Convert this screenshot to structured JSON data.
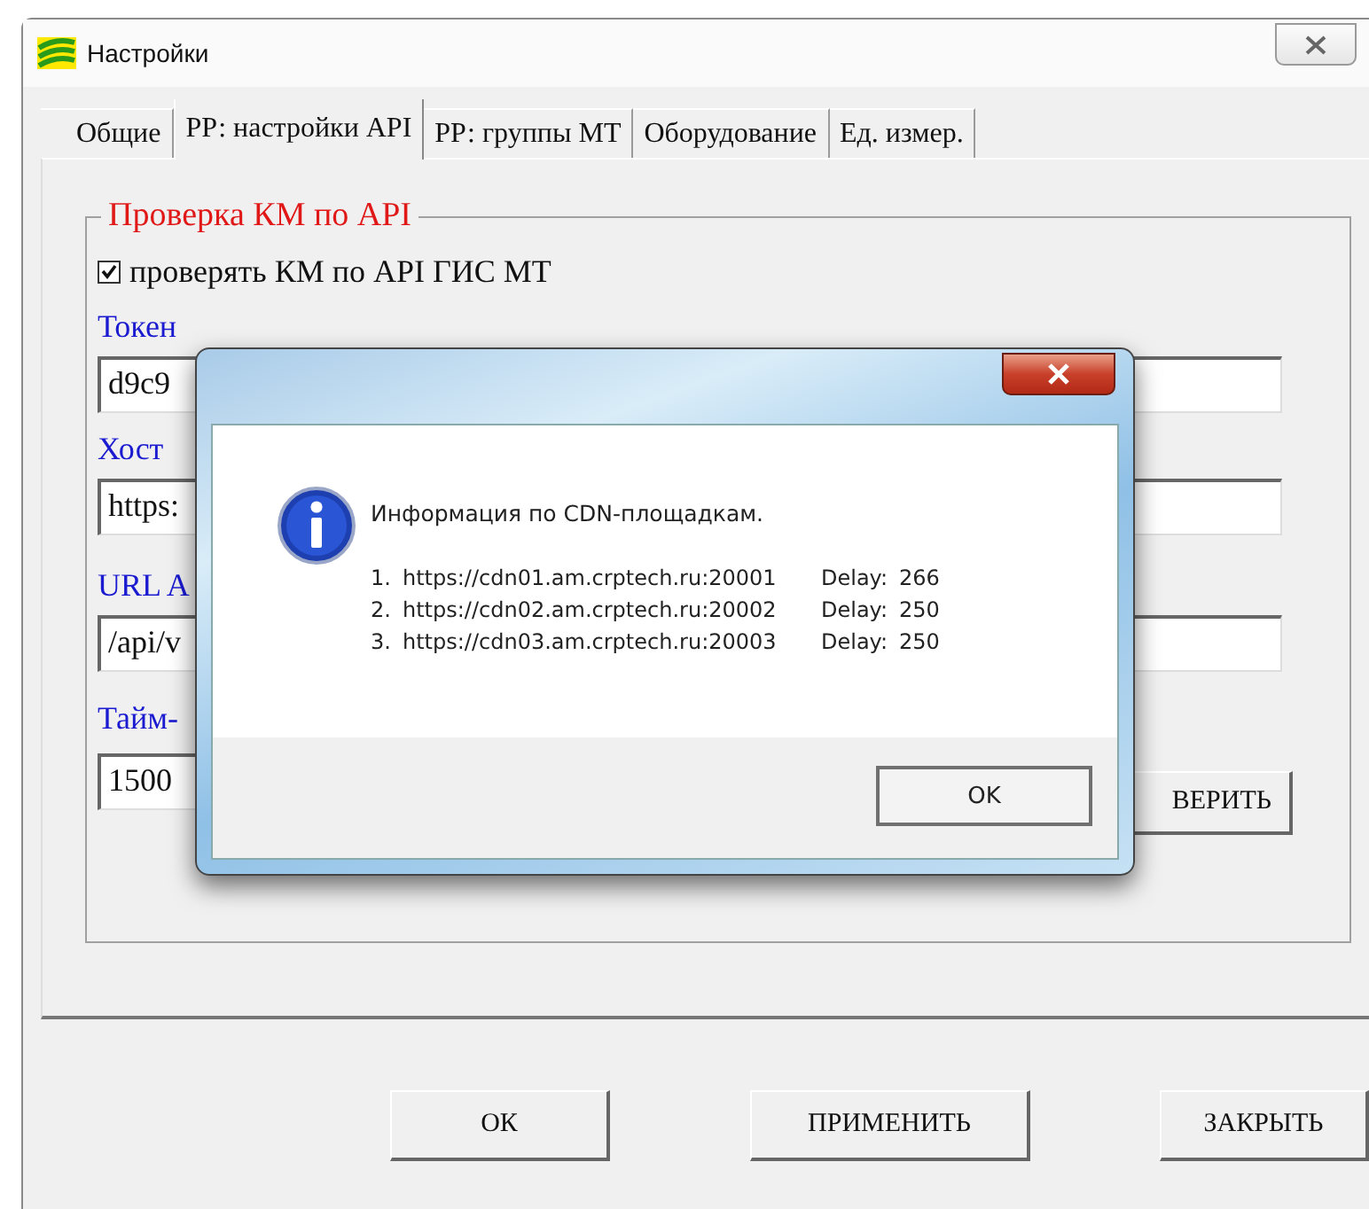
{
  "window": {
    "title": "Настройки"
  },
  "tabs": [
    {
      "label": "Общие",
      "selected": false
    },
    {
      "label": "РР: настройки API",
      "selected": true
    },
    {
      "label": "РР: группы МТ",
      "selected": false
    },
    {
      "label": "Оборудование",
      "selected": false
    },
    {
      "label": "Ед. измер.",
      "selected": false
    }
  ],
  "group": {
    "legend": "Проверка КМ по API",
    "checkbox": {
      "label": "проверять КМ по API ГИС МТ",
      "checked": true
    },
    "fields": [
      {
        "label": "Токен",
        "value": "d9c9"
      },
      {
        "label": "Хост",
        "value": "https:"
      },
      {
        "label": "URL A",
        "value": "/api/v"
      },
      {
        "label": "Тайм-",
        "value": "1500"
      }
    ],
    "check_button": "ВЕРИТЬ"
  },
  "buttons": [
    "ОК",
    "ПРИМЕНИТЬ",
    "ЗАКРЫТЬ"
  ],
  "dialog": {
    "message": "Информация по CDN-площадкам.",
    "rows": [
      {
        "index": "1.",
        "url": "https://cdn01.am.crptech.ru:20001",
        "delay_label": "Delay:",
        "delay": "266"
      },
      {
        "index": "2.",
        "url": "https://cdn02.am.crptech.ru:20002",
        "delay_label": "Delay:",
        "delay": "250"
      },
      {
        "index": "3.",
        "url": "https://cdn03.am.crptech.ru:20003",
        "delay_label": "Delay:",
        "delay": "250"
      }
    ],
    "button": "OK"
  }
}
